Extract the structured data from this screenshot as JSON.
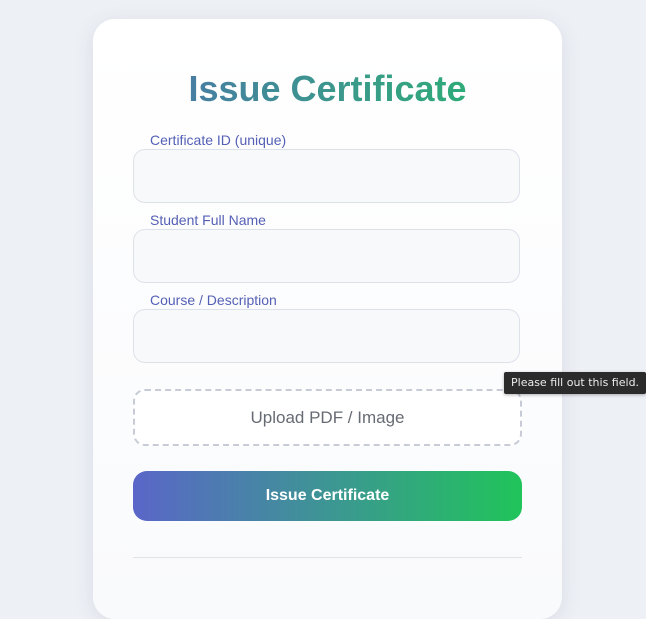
{
  "form": {
    "title": "Issue Certificate",
    "fields": [
      {
        "label": "Certificate ID (unique)",
        "value": "",
        "placeholder": ""
      },
      {
        "label": "Student Full Name",
        "value": "",
        "placeholder": ""
      },
      {
        "label": "Course / Description",
        "value": "",
        "placeholder": ""
      }
    ],
    "upload_label": "Upload PDF / Image",
    "submit_label": "Issue Certificate"
  },
  "validation_tooltip": "Please fill out this field.",
  "colors": {
    "background": "#edf0f5",
    "label": "#5560b5",
    "gradient_start": "#5a66c8",
    "gradient_end": "#20c45a"
  }
}
